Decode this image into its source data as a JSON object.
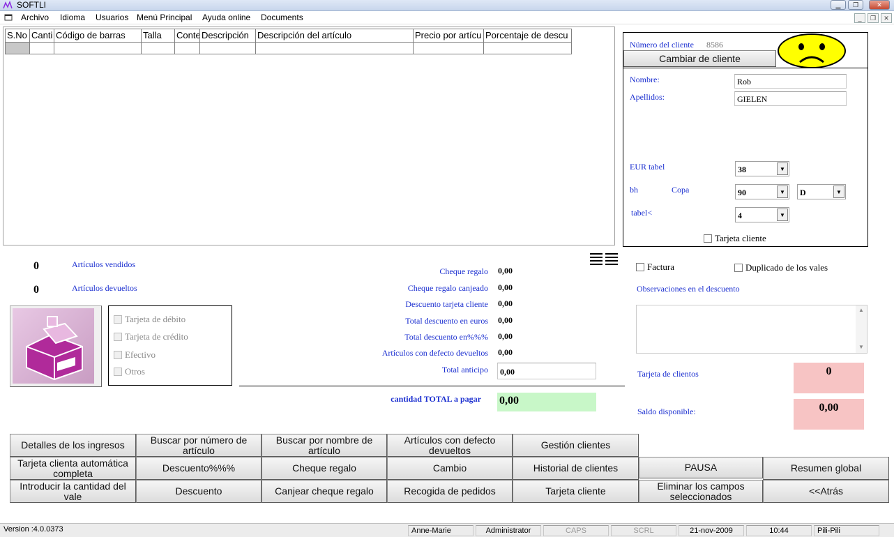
{
  "window": {
    "title": "SOFTLI"
  },
  "menu": [
    "Archivo",
    "Idioma",
    "Usuarios",
    "Menú Principal",
    "Ayuda online",
    "Documents"
  ],
  "grid": {
    "columns": [
      "S.No",
      "Canti",
      "Código de barras",
      "Talla",
      "Conte",
      "Descripción",
      "Descripción del artículo",
      "Precio por artícu",
      "Porcentaje de descu"
    ]
  },
  "customer": {
    "number_label": "Número del cliente",
    "number_value": "8586",
    "change_button": "Cambiar de cliente",
    "name_label": "Nombre:",
    "name_value": "Rob",
    "surname_label": "Apellidos:",
    "surname_value": "GIELEN",
    "eur_label": "EUR tabel",
    "eur_value": "38",
    "bh_label": "bh",
    "copa_label": "Copa",
    "bh_value": "90",
    "copa_value": "D",
    "tabel_label": "tabel<",
    "tabel_value": "4",
    "card_checkbox": "Tarjeta cliente",
    "mood": "sad-face"
  },
  "counts": {
    "sold_value": "0",
    "sold_label": "Artículos vendidos",
    "returned_value": "0",
    "returned_label": "Artículos devueltos"
  },
  "payment": {
    "icon": "cash-register-icon",
    "options": [
      "Tarjeta de débito",
      "Tarjeta de crédito",
      "Efectivo",
      "Otros"
    ]
  },
  "totals": [
    {
      "label": "Cheque regalo",
      "value": "0,00"
    },
    {
      "label": "Cheque regalo canjeado",
      "value": "0,00"
    },
    {
      "label": "Descuento tarjeta cliente",
      "value": "0,00"
    },
    {
      "label": "Total descuento en euros",
      "value": "0,00"
    },
    {
      "label": "Total descuento en%%%",
      "value": "0,00"
    },
    {
      "label": "Artículos con defecto devueltos",
      "value": "0,00"
    }
  ],
  "advance": {
    "label": "Total anticipo",
    "value": "0,00"
  },
  "grand_total": {
    "label": "cantidad TOTAL a pagar",
    "value": "0,00"
  },
  "invoice": {
    "factura": "Factura",
    "duplicate": "Duplicado de los vales",
    "observations_label": "Observaciones en el descuento",
    "card_label": "Tarjeta de clientos",
    "card_value": "0",
    "balance_label": "Saldo disponible:",
    "balance_value": "0,00"
  },
  "buttons": {
    "row1": [
      "Detalles de los ingresos",
      "Buscar por número de artículo",
      "Buscar por nombre de artículo",
      "Artículos con defecto devueltos",
      "Gestión clientes"
    ],
    "row2": [
      "Tarjeta clienta automática completa",
      "Descuento%%%",
      "Cheque regalo",
      "Cambio",
      "Historial de clientes",
      "PAUSA",
      "Resumen global"
    ],
    "row3": [
      "Introducir la cantidad del vale",
      "Descuento",
      "Canjear cheque regalo",
      "Recogida de pedidos",
      "Tarjeta cliente",
      "Eliminar los campos seleccionados",
      "<<Atrás"
    ]
  },
  "status": {
    "version": "Version :4.0.0373",
    "user": "Anne-Marie",
    "role": "Administrator",
    "caps": "CAPS",
    "scrl": "SCRL",
    "date": "21-nov-2009",
    "time": "10:44",
    "shop": "Pili-Pili"
  },
  "colors": {
    "label_blue": "#1b2fd0",
    "total_green": "#c8f7c8",
    "alert_pink": "#f7c4c4",
    "smiley_yellow": "#ffff00"
  }
}
